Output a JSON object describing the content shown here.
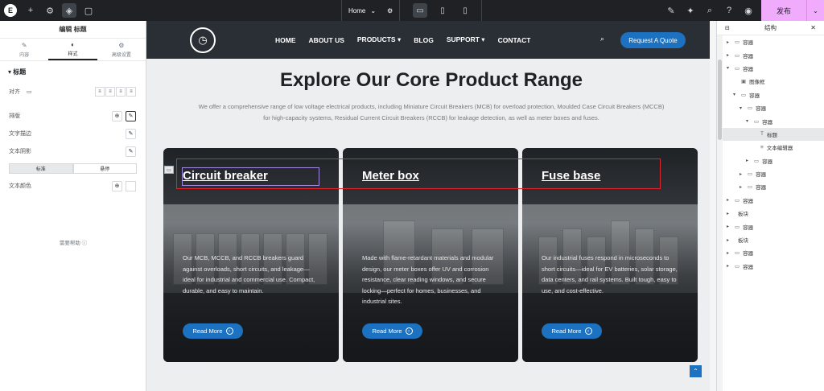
{
  "topbar": {
    "page_name": "Home",
    "publish_label": "发布"
  },
  "left_panel": {
    "title": "编辑 标题",
    "tabs": [
      {
        "label": "内容"
      },
      {
        "label": "样式"
      },
      {
        "label": "高级设置"
      }
    ],
    "section": "标题",
    "rows": {
      "align": "对齐",
      "typography": "排版",
      "text_stroke": "文字描边",
      "text_shadow": "文本阴影",
      "text_color": "文本颜色"
    },
    "state_tabs": [
      "标准",
      "悬停"
    ],
    "help": "需要帮助"
  },
  "site": {
    "nav": [
      "HOME",
      "ABOUT US",
      "PRODUCTS",
      "BLOG",
      "SUPPORT",
      "CONTACT"
    ],
    "quote_button": "Request A Quote",
    "hero_title": "Explore Our Core Product Range",
    "hero_desc": "We offer a comprehensive range of low voltage electrical products, including Miniature Circuit Breakers (MCB) for overload protection, Moulded Case Circuit Breakers (MCCB) for high-capacity systems, Residual Current Circuit Breakers (RCCB) for leakage detection, as well as meter boxes and fuses.",
    "cards": [
      {
        "title": "Circuit breaker",
        "text": "Our MCB, MCCB, and RCCB breakers guard against overloads, short circuits, and leakage—ideal for industrial and commercial use. Compact, durable, and easy to maintain.",
        "button": "Read More"
      },
      {
        "title": "Meter box",
        "text": "Made with flame-retardant materials and modular design, our meter boxes offer UV and corrosion resistance, clear reading windows, and secure locking—perfect for homes, businesses, and industrial sites.",
        "button": "Read More"
      },
      {
        "title": "Fuse base",
        "text": "Our industrial fuses respond in microseconds to short circuits—ideal for EV batteries, solar storage, data centers, and rail systems. Built tough, easy to use, and cost-effective.",
        "button": "Read More"
      }
    ]
  },
  "right_panel": {
    "title": "结构",
    "items": [
      {
        "label": "容器",
        "indent": 0,
        "caret": "▸",
        "icon": "▭"
      },
      {
        "label": "容器",
        "indent": 0,
        "caret": "▸",
        "icon": "▭"
      },
      {
        "label": "容器",
        "indent": 0,
        "caret": "▾",
        "icon": "▭"
      },
      {
        "label": "图像框",
        "indent": 1,
        "caret": "",
        "icon": "▣"
      },
      {
        "label": "容器",
        "indent": 1,
        "caret": "▾",
        "icon": "▭"
      },
      {
        "label": "容器",
        "indent": 2,
        "caret": "▾",
        "icon": "▭"
      },
      {
        "label": "容器",
        "indent": 3,
        "caret": "▾",
        "icon": "▭"
      },
      {
        "label": "标题",
        "indent": 4,
        "caret": "",
        "icon": "T"
      },
      {
        "label": "文本编辑器",
        "indent": 4,
        "caret": "",
        "icon": "≡"
      },
      {
        "label": "容器",
        "indent": 3,
        "caret": "▸",
        "icon": "▭"
      },
      {
        "label": "容器",
        "indent": 2,
        "caret": "▸",
        "icon": "▭"
      },
      {
        "label": "容器",
        "indent": 2,
        "caret": "▸",
        "icon": "▭"
      },
      {
        "label": "容器",
        "indent": 0,
        "caret": "▸",
        "icon": "▭"
      },
      {
        "label": "板块",
        "indent": 0,
        "caret": "▸",
        "icon": ""
      },
      {
        "label": "容器",
        "indent": 0,
        "caret": "▸",
        "icon": "▭"
      },
      {
        "label": "板块",
        "indent": 0,
        "caret": "▸",
        "icon": ""
      },
      {
        "label": "容器",
        "indent": 0,
        "caret": "▸",
        "icon": "▭"
      },
      {
        "label": "容器",
        "indent": 0,
        "caret": "▸",
        "icon": "▭"
      }
    ]
  },
  "colors": {
    "topbar": "#1f2124",
    "accent_blue": "#1c72c0",
    "publish": "#f0abfc",
    "selection_red": "#e0242b"
  }
}
